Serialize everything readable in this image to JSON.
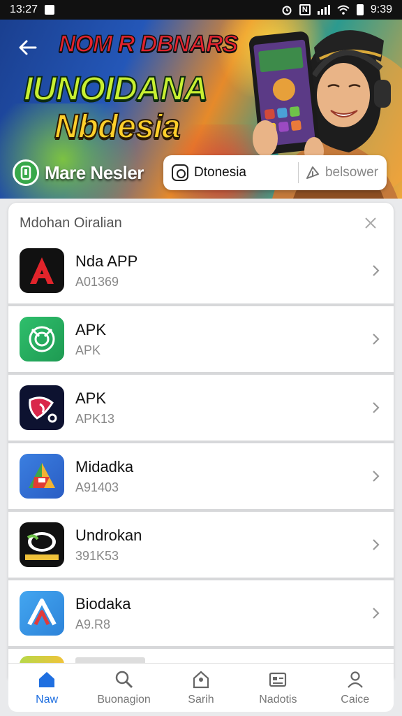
{
  "status_bar": {
    "time": "13:27",
    "right_time": "9:39"
  },
  "banner": {
    "headline": "NOM R DBNARS",
    "title_line1": "IUNOIDANA",
    "title_line2": "Nbdesia",
    "brand": "Mare Nesler",
    "search": {
      "region": "Dtonesia",
      "download_label": "belsower"
    }
  },
  "list": {
    "title": "Mdohan Oiralian",
    "apps": [
      {
        "name": "Nda APP",
        "subtitle": "A01369",
        "icon": "letter-a-icon"
      },
      {
        "name": "APK",
        "subtitle": "APK",
        "icon": "green-logo-icon"
      },
      {
        "name": "APK",
        "subtitle": "APK13",
        "icon": "dark-logo-icon"
      },
      {
        "name": "Midadka",
        "subtitle": "A91403",
        "icon": "triangle-logo-icon"
      },
      {
        "name": "Undrokan",
        "subtitle": "391K53",
        "icon": "emblem-logo-icon"
      },
      {
        "name": "Biodaka",
        "subtitle": "A9.R8",
        "icon": "blue-a-icon"
      }
    ]
  },
  "bottom_nav": [
    {
      "label": "Naw",
      "icon": "home-icon",
      "active": true
    },
    {
      "label": "Buonagion",
      "icon": "search-icon",
      "active": false
    },
    {
      "label": "Sarih",
      "icon": "location-icon",
      "active": false
    },
    {
      "label": "Nadotis",
      "icon": "card-icon",
      "active": false
    },
    {
      "label": "Caice",
      "icon": "profile-icon",
      "active": false
    }
  ],
  "colors": {
    "accent": "#1f6fe0",
    "divider": "#d7d8da"
  }
}
